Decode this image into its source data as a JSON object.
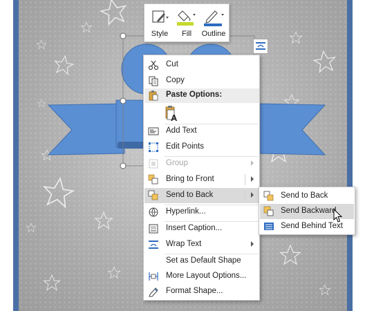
{
  "mini_toolbar": {
    "style_label": "Style",
    "fill_label": "Fill",
    "outline_label": "Outline"
  },
  "context_menu": {
    "items": [
      {
        "label": "Cut",
        "icon": "scissors-icon",
        "enabled": true
      },
      {
        "label": "Copy",
        "icon": "copy-icon",
        "enabled": true
      },
      {
        "label": "Paste Options:",
        "icon": "paste-icon",
        "header": true
      },
      {
        "label": "Add Text",
        "icon": "add-text-icon",
        "enabled": true
      },
      {
        "label": "Edit Points",
        "icon": "edit-points-icon",
        "enabled": true
      },
      {
        "label": "Group",
        "icon": "group-icon",
        "enabled": false,
        "submenu": true
      },
      {
        "label": "Bring to Front",
        "icon": "bring-to-front-icon",
        "enabled": true,
        "submenu": true
      },
      {
        "label": "Send to Back",
        "icon": "send-to-back-icon",
        "enabled": true,
        "submenu": true,
        "active": true
      },
      {
        "label": "Hyperlink...",
        "icon": "hyperlink-icon",
        "enabled": true
      },
      {
        "label": "Insert Caption...",
        "icon": "insert-caption-icon",
        "enabled": true
      },
      {
        "label": "Wrap Text",
        "icon": "wrap-text-icon",
        "enabled": true,
        "submenu": true
      },
      {
        "label": "Set as Default Shape",
        "icon": "",
        "enabled": true
      },
      {
        "label": "More Layout Options...",
        "icon": "layout-options-icon",
        "enabled": true
      },
      {
        "label": "Format Shape...",
        "icon": "format-shape-icon",
        "enabled": true
      }
    ]
  },
  "submenu": {
    "items": [
      {
        "label": "Send to Back",
        "icon": "send-to-back-icon"
      },
      {
        "label": "Send Backward",
        "icon": "send-backward-icon",
        "highlighted": true
      },
      {
        "label": "Send Behind Text",
        "icon": "send-behind-text-icon"
      }
    ]
  },
  "colors": {
    "page_border": "#4a6fa5",
    "shape_fill": "#5b8fd4",
    "fill_swatch": "#c5d92c",
    "outline_swatch": "#2e6cc0",
    "menu_highlight": "#dadada"
  }
}
